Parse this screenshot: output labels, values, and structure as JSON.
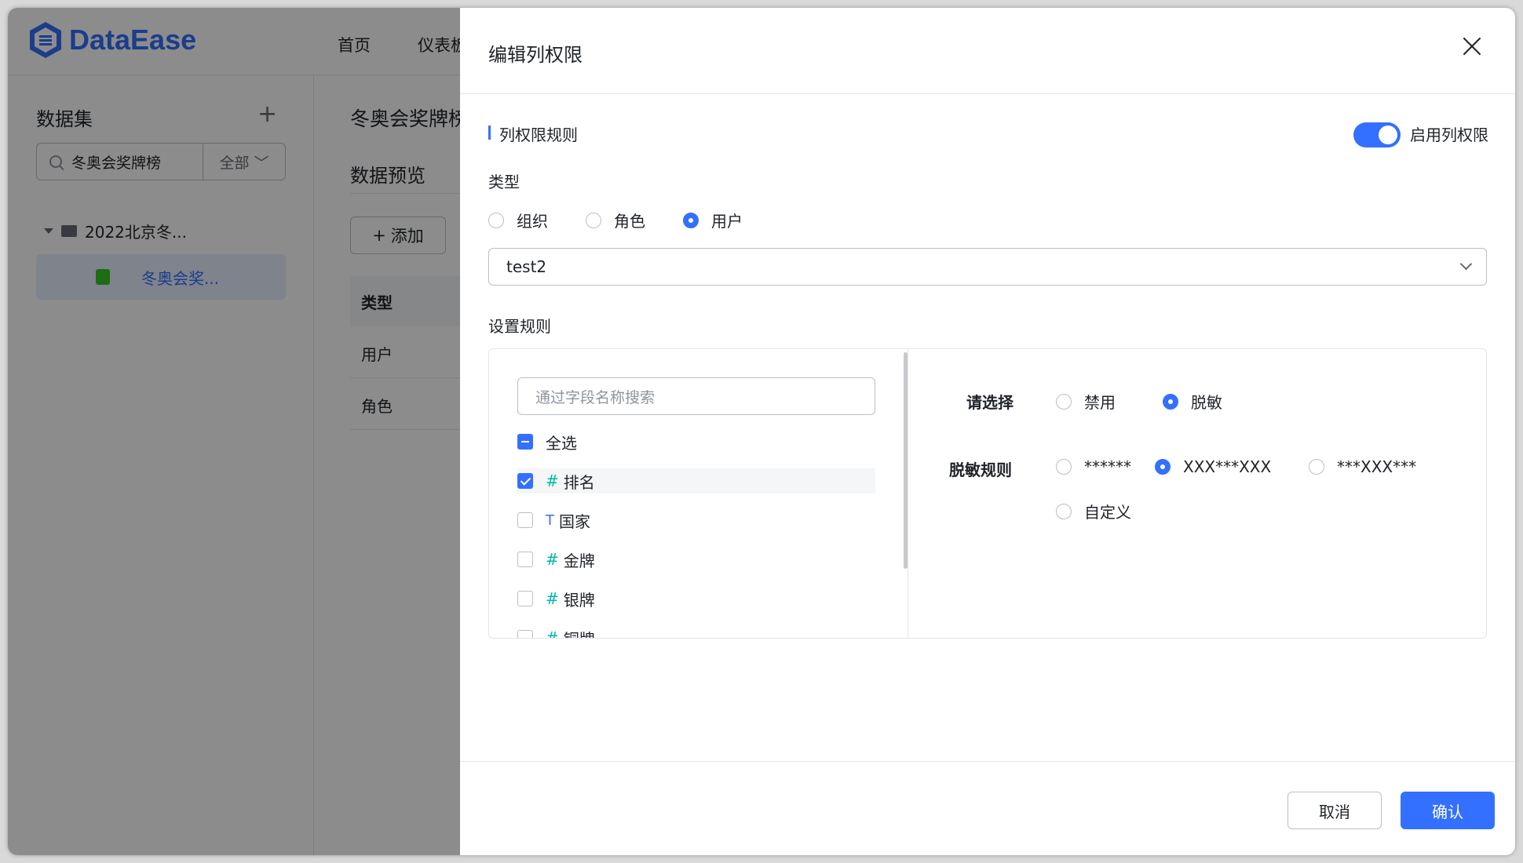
{
  "app": {
    "logo_text": "DataEase",
    "nav": [
      "首页",
      "仪表板"
    ]
  },
  "sidebar": {
    "title": "数据集",
    "search_value": "冬奥会奖牌榜",
    "filter": "全部",
    "folder": "2022北京冬...",
    "file": "冬奥会奖..."
  },
  "main": {
    "title": "冬奥会奖牌榜",
    "subtitle": "数据预览",
    "add_label": "添加",
    "table_header": "类型",
    "rows": [
      "用户",
      "角色"
    ]
  },
  "drawer": {
    "title": "编辑列权限",
    "section_title": "列权限规则",
    "toggle_label": "启用列权限",
    "toggle_on": true,
    "type_label": "类型",
    "type_options": [
      "组织",
      "角色",
      "用户"
    ],
    "type_selected": "用户",
    "select_value": "test2",
    "rules_label": "设置规则",
    "field_search_placeholder": "通过字段名称搜索",
    "select_all": "全选",
    "fields": [
      {
        "type": "#",
        "name": "排名",
        "checked": true
      },
      {
        "type": "T",
        "name": "国家",
        "checked": false
      },
      {
        "type": "#",
        "name": "金牌",
        "checked": false
      },
      {
        "type": "#",
        "name": "银牌",
        "checked": false
      },
      {
        "type": "#",
        "name": "铜牌",
        "checked": false
      }
    ],
    "choose_label": "请选择",
    "choose_options": [
      "禁用",
      "脱敏"
    ],
    "choose_selected": "脱敏",
    "mask_label": "脱敏规则",
    "mask_options": [
      "******",
      "XXX***XXX",
      "***XXX***",
      "自定义"
    ],
    "mask_selected": "XXX***XXX",
    "cancel": "取消",
    "confirm": "确认"
  },
  "colors": {
    "primary": "#3370ff",
    "field_num": "#00b8a9"
  }
}
